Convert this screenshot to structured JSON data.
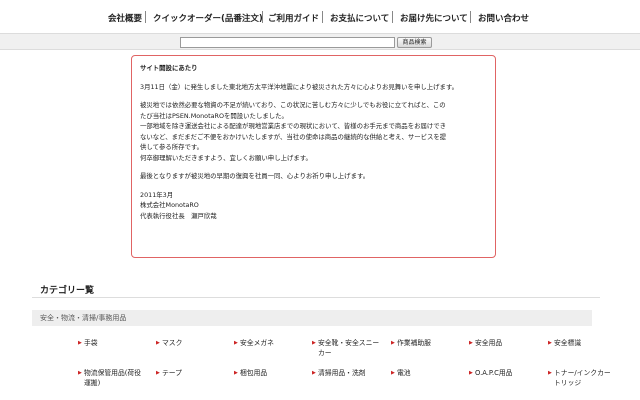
{
  "nav": {
    "items": [
      "会社概要",
      "クイックオーダー(品番注文)",
      "ご利用ガイド",
      "お支払について",
      "お届け先について",
      "お問い合わせ"
    ]
  },
  "search": {
    "value": "",
    "button_label": "商品検索"
  },
  "notice": {
    "title": "サイト開設にあたり",
    "paragraph1": "3月11日（金）に発生しました東北地方太平洋沖地震により被災された方々に心よりお見舞いを申し上げます。",
    "paragraph2": [
      "被災地では依然必要な物資の不足が続いており、この状況に苦しむ方々に少しでもお役に立てればと、この",
      "たび当社はPSEN.MonotaROを開設いたしました。",
      "一部地域を除き運送会社による配達が現地営業店までの現状において、皆様のお手元まで商品をお届けでき",
      "ないなど、まだまだご不便をおかけいたしますが、当社の使命は商品の継続的な供給と考え、サービスを提",
      "供して参る所存です。",
      "何卒御理解いただきますよう、宜しくお願い申し上げます。"
    ],
    "paragraph3": "最後となりますが被災地の早期の復興を社員一同、心よりお祈り申し上げます。",
    "date": "2011年3月",
    "company": "株式会社MonotaRO",
    "signer": "代表執行役社長　瀬戸欣哉"
  },
  "categories": {
    "heading": "カテゴリー覧",
    "section_title": "安全・物流・清掃/事務用品",
    "items": [
      {
        "label": "手袋"
      },
      {
        "label": "マスク"
      },
      {
        "label": "安全メガネ"
      },
      {
        "label": "安全靴・安全スニー",
        "label2": "カー"
      },
      {
        "label": "作業補助服"
      },
      {
        "label": "安全用品"
      },
      {
        "label": "安全標識"
      },
      {
        "label": "物流保管用品(荷役",
        "label2": "運搬)"
      },
      {
        "label": "テープ"
      },
      {
        "label": "梱包用品"
      },
      {
        "label": "清掃用品・洗剤"
      },
      {
        "label": "電池"
      },
      {
        "label": "O.A.P.C用品"
      },
      {
        "label": "トナー/インクカー",
        "label2": "トリッジ"
      }
    ]
  }
}
